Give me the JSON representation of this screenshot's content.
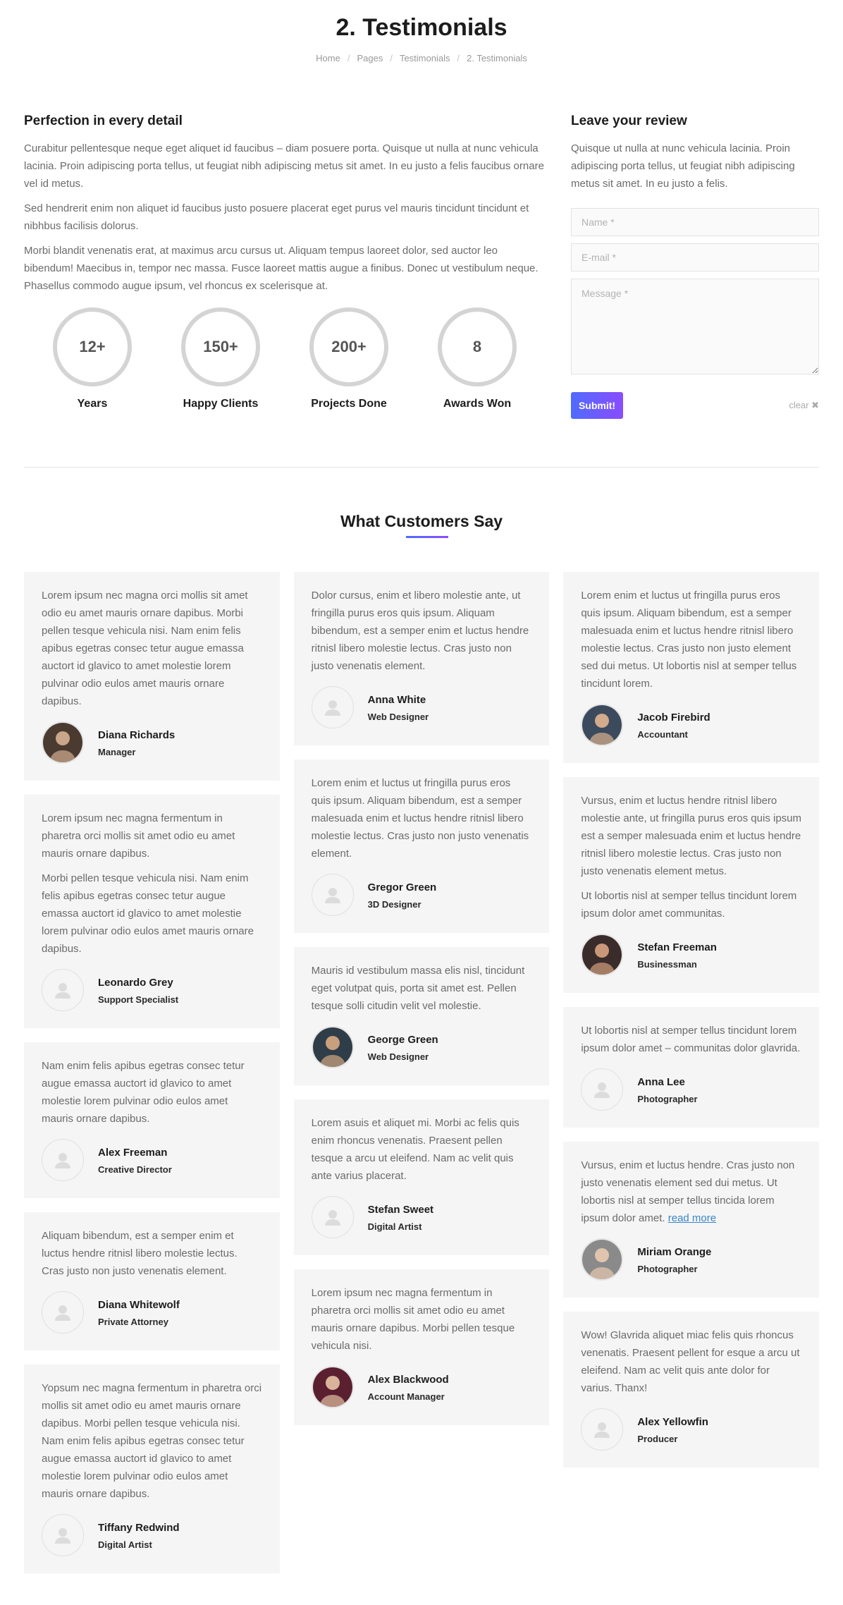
{
  "page": {
    "title": "2. Testimonials",
    "breadcrumb": [
      "Home",
      "Pages",
      "Testimonials",
      "2. Testimonials"
    ]
  },
  "about": {
    "heading": "Perfection in every detail",
    "paragraphs": [
      "Curabitur pellentesque neque eget aliquet id faucibus – diam posuere porta. Quisque ut nulla at nunc vehicula lacinia. Proin adipiscing porta tellus, ut feugiat nibh adipiscing metus sit amet. In eu justo a felis faucibus ornare vel id metus.",
      "Sed hendrerit enim non aliquet id faucibus justo posuere placerat eget purus vel mauris tincidunt tincidunt et nibhbus facilisis dolorus.",
      "Morbi blandit venenatis erat, at maximus arcu cursus ut. Aliquam tempus laoreet dolor, sed auctor leo bibendum! Maecibus in, tempor nec massa. Fusce laoreet mattis augue a finibus. Donec ut vestibulum neque. Phasellus commodo augue ipsum, vel rhoncus ex scelerisque at."
    ],
    "stats": [
      {
        "value": "12+",
        "label": "Years"
      },
      {
        "value": "150+",
        "label": "Happy Clients"
      },
      {
        "value": "200+",
        "label": "Projects Done"
      },
      {
        "value": "8",
        "label": "Awards Won"
      }
    ]
  },
  "review_form": {
    "heading": "Leave your review",
    "text": "Quisque ut nulla at nunc vehicula lacinia. Proin adipiscing porta tellus, ut feugiat nibh adipiscing metus sit amet. In eu justo a felis.",
    "name_placeholder": "Name *",
    "email_placeholder": "E-mail *",
    "message_placeholder": "Message *",
    "submit_label": "Submit!",
    "clear_label": "clear ✖"
  },
  "testimonials": {
    "heading": "What Customers Say",
    "accent_gradient": [
      "#4f6bff",
      "#8a4dff"
    ],
    "columns": [
      [
        {
          "paragraphs": [
            "Lorem ipsum nec magna orci mollis sit amet odio eu amet mauris ornare dapibus. Morbi pellen tesque vehicula nisi. Nam enim felis apibus egetras consec tetur augue emassa auctort id glavico to amet molestie lorem pulvinar odio eulos amet mauris ornare dapibus."
          ],
          "name": "Diana Richards",
          "role": "Manager",
          "avatar": "photo",
          "avatar_colors": [
            "#4a3a30",
            "#c9a58a"
          ]
        },
        {
          "paragraphs": [
            "Lorem ipsum nec magna fermentum in pharetra orci mollis sit amet odio eu amet mauris ornare dapibus.",
            "Morbi pellen tesque vehicula nisi. Nam enim felis apibus egetras consec tetur augue emassa auctort id glavico to amet molestie lorem pulvinar odio eulos amet mauris ornare dapibus."
          ],
          "name": "Leonardo Grey",
          "role": "Support Specialist",
          "avatar": "placeholder"
        },
        {
          "paragraphs": [
            "Nam enim felis apibus egetras consec tetur augue emassa auctort id glavico to amet molestie lorem pulvinar odio eulos amet mauris ornare dapibus."
          ],
          "name": "Alex Freeman",
          "role": "Creative Director",
          "avatar": "placeholder"
        },
        {
          "paragraphs": [
            "Aliquam bibendum, est a semper enim et luctus hendre ritnisl libero molestie lectus. Cras justo non justo venenatis element."
          ],
          "name": "Diana Whitewolf",
          "role": "Private Attorney",
          "avatar": "placeholder"
        },
        {
          "paragraphs": [
            "Yopsum nec magna fermentum in pharetra orci mollis sit amet odio eu amet mauris ornare dapibus. Morbi pellen tesque vehicula nisi. Nam enim felis apibus egetras consec tetur augue emassa auctort id glavico to amet molestie lorem pulvinar odio eulos amet mauris ornare dapibus."
          ],
          "name": "Tiffany Redwind",
          "role": "Digital Artist",
          "avatar": "placeholder"
        }
      ],
      [
        {
          "paragraphs": [
            "Dolor cursus, enim et libero molestie ante, ut fringilla purus eros quis ipsum. Aliquam bibendum, est a semper enim et luctus hendre ritnisl libero molestie lectus. Cras justo non justo venenatis element."
          ],
          "name": "Anna White",
          "role": "Web Designer",
          "avatar": "placeholder"
        },
        {
          "paragraphs": [
            "Lorem enim et luctus ut fringilla purus eros quis ipsum. Aliquam bibendum, est a semper malesuada enim et luctus hendre ritnisl libero molestie lectus. Cras justo non justo venenatis element."
          ],
          "name": "Gregor Green",
          "role": "3D Designer",
          "avatar": "placeholder"
        },
        {
          "paragraphs": [
            "Mauris id vestibulum massa elis nisl, tincidunt eget volutpat quis, porta sit amet est. Pellen tesque solli citudin velit vel molestie."
          ],
          "name": "George Green",
          "role": "Web Designer",
          "avatar": "photo",
          "avatar_colors": [
            "#2f3d48",
            "#c8a07e"
          ]
        },
        {
          "paragraphs": [
            "Lorem asuis et aliquet mi. Morbi ac felis quis enim rhoncus venenatis. Praesent pellen tesque a arcu ut eleifend. Nam ac velit quis ante varius placerat."
          ],
          "name": "Stefan Sweet",
          "role": "Digital Artist",
          "avatar": "placeholder"
        },
        {
          "paragraphs": [
            "Lorem ipsum nec magna fermentum in pharetra orci mollis sit amet odio eu amet mauris ornare dapibus. Morbi pellen tesque vehicula nisi."
          ],
          "name": "Alex Blackwood",
          "role": "Account Manager",
          "avatar": "photo",
          "avatar_colors": [
            "#5a2030",
            "#d9b49a"
          ]
        }
      ],
      [
        {
          "paragraphs": [
            "Lorem enim et luctus ut fringilla purus eros quis ipsum. Aliquam bibendum, est a semper malesuada enim et luctus hendre ritnisl libero molestie lectus. Cras justo non justo element sed dui metus. Ut lobortis nisl at semper tellus tincidunt lorem."
          ],
          "name": "Jacob Firebird",
          "role": "Accountant",
          "avatar": "photo",
          "avatar_colors": [
            "#3b4a5c",
            "#d2aa8c"
          ]
        },
        {
          "paragraphs": [
            "Vursus, enim et luctus hendre ritnisl libero molestie ante, ut fringilla purus eros quis ipsum est a semper malesuada enim et luctus hendre ritnisl libero molestie lectus. Cras justo non justo venenatis element metus.",
            "Ut lobortis nisl at semper tellus tincidunt lorem ipsum dolor amet communitas."
          ],
          "name": "Stefan Freeman",
          "role": "Businessman",
          "avatar": "photo",
          "avatar_colors": [
            "#3a2c2a",
            "#c89878"
          ]
        },
        {
          "paragraphs": [
            "Ut lobortis nisl at semper tellus tincidunt lorem ipsum dolor amet – communitas dolor glavrida."
          ],
          "name": "Anna Lee",
          "role": "Photographer",
          "avatar": "placeholder"
        },
        {
          "paragraphs": [
            "Vursus, enim et luctus hendre. Cras justo non justo venenatis element sed dui metus. Ut lobortis nisl at semper tellus tincida lorem ipsum dolor amet."
          ],
          "read_more": "read more",
          "name": "Miriam Orange",
          "role": "Photographer",
          "avatar": "photo",
          "avatar_colors": [
            "#8a8a8a",
            "#e0c4ae"
          ]
        },
        {
          "paragraphs": [
            "Wow! Glavrida aliquet miac felis quis rhoncus venenatis. Praesent pellent for esque a arcu ut eleifend. Nam ac velit quis ante dolor for varius. Thanx!"
          ],
          "name": "Alex Yellowfin",
          "role": "Producer",
          "avatar": "placeholder"
        }
      ]
    ]
  }
}
